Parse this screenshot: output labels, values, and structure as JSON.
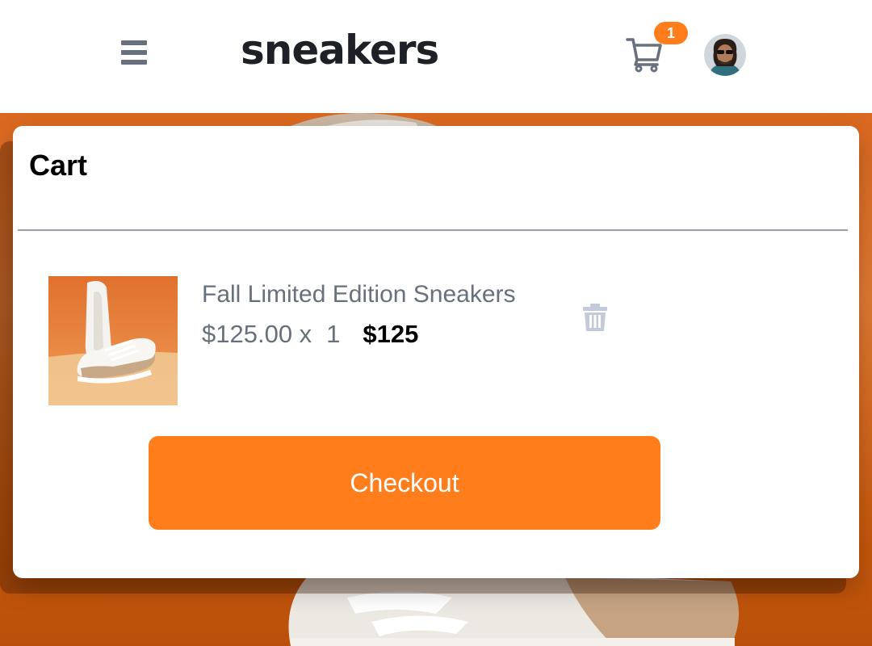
{
  "header": {
    "logo": "sneakers",
    "cart_count": "1"
  },
  "cart": {
    "title": "Cart",
    "items": [
      {
        "name": "Fall Limited Edition Sneakers",
        "unit_price": "$125.00 x",
        "quantity": "1",
        "total": "$125"
      }
    ],
    "checkout_label": "Checkout"
  },
  "icons": {
    "menu": "menu-icon",
    "cart": "cart-icon",
    "delete": "trash-icon"
  },
  "colors": {
    "accent": "#ff7e1b",
    "text_dark": "#1d2026",
    "text_muted": "#69707d",
    "icon_light": "#c3cad9"
  }
}
